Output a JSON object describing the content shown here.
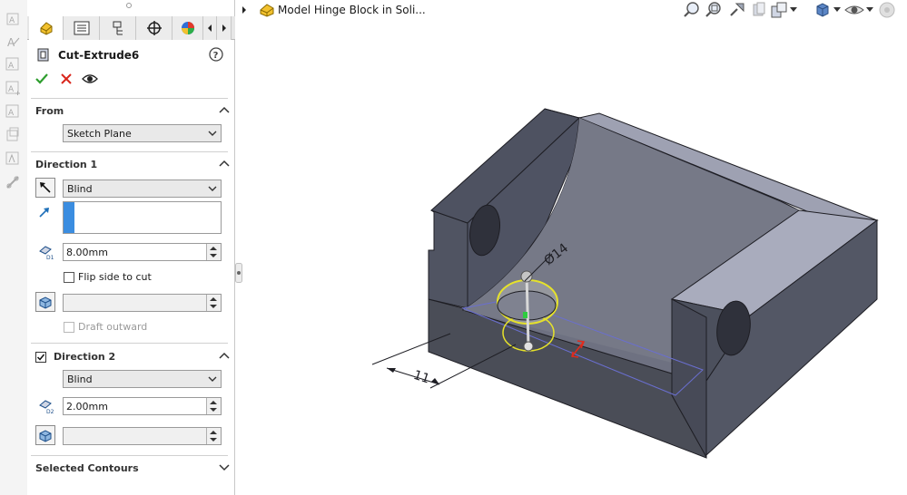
{
  "window": {
    "tree_item_label": "Model Hinge Block in Soli..."
  },
  "feature": {
    "name": "Cut-Extrude6"
  },
  "from": {
    "title": "From",
    "value": "Sketch Plane"
  },
  "direction1": {
    "title": "Direction 1",
    "end_condition": "Blind",
    "depth": "8.00mm",
    "flip_label": "Flip side to cut",
    "draft_value": "",
    "draft_outward_label": "Draft outward"
  },
  "direction2": {
    "title": "Direction 2",
    "end_condition": "Blind",
    "depth": "2.00mm",
    "draft_value": ""
  },
  "selected_contours": {
    "title": "Selected Contours"
  },
  "dimensions": {
    "diameter": "Ø14",
    "linear": "11"
  },
  "colors": {
    "accent_blue": "#3b8de0",
    "ok_green": "#2e9e2e",
    "cancel_red": "#d9261c",
    "part_gray": "#7a7d8a"
  }
}
